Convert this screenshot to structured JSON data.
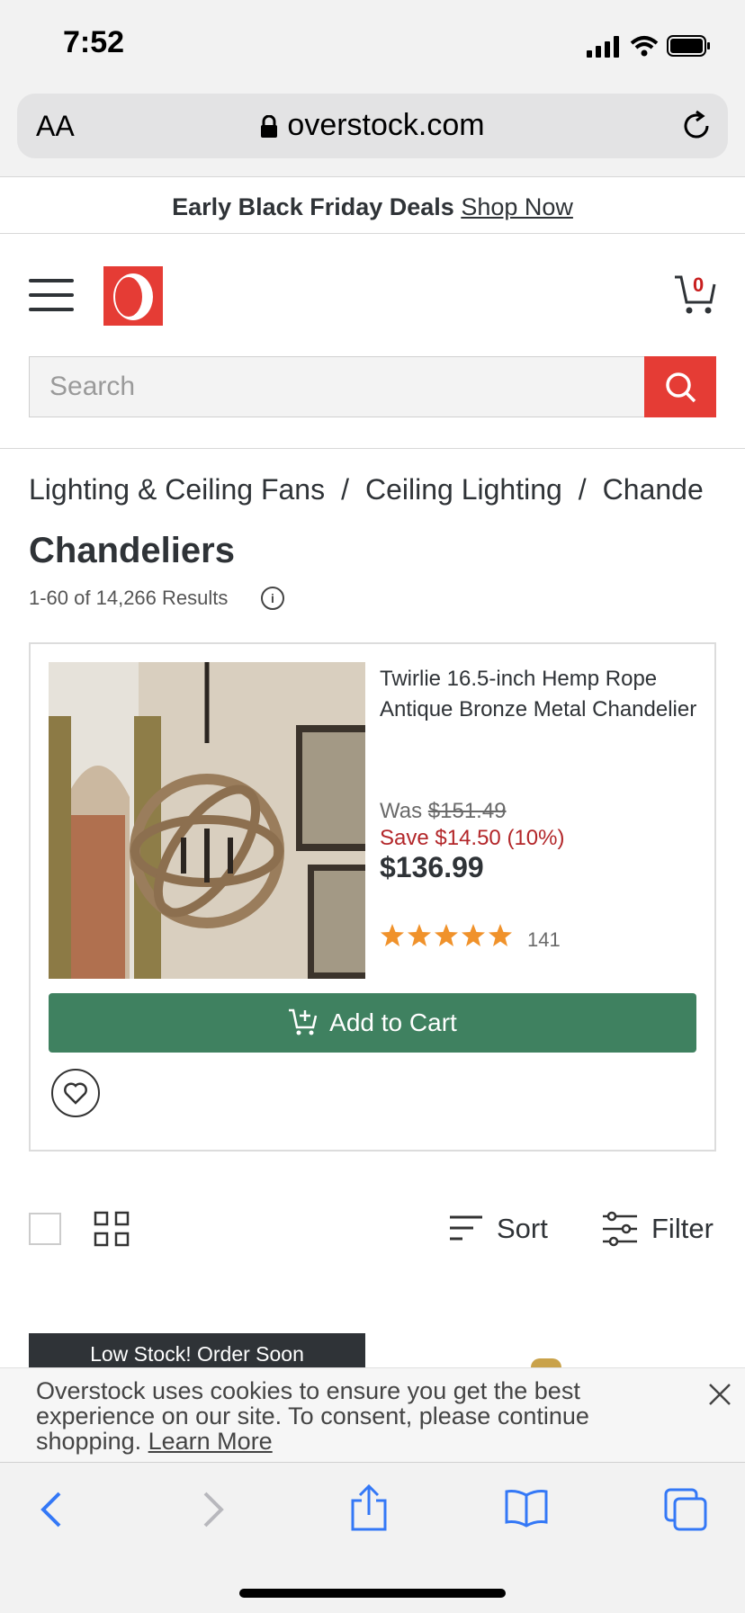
{
  "status_bar": {
    "time": "7:52"
  },
  "browser": {
    "text_size_label": "AA",
    "url": "overstock.com"
  },
  "promo": {
    "text": "Early Black Friday Deals",
    "link": "Shop Now"
  },
  "header": {
    "cart_count": "0",
    "search_placeholder": "Search"
  },
  "breadcrumb": {
    "items": [
      "Lighting & Ceiling Fans",
      "Ceiling Lighting",
      "Chande"
    ],
    "separator": "/"
  },
  "page": {
    "title": "Chandeliers",
    "results": "1-60 of 14,266 Results"
  },
  "product": {
    "title": "Twirlie 16.5-inch Hemp Rope Antique Bronze Metal Chandelier",
    "was_label": "Was",
    "was_price": "$151.49",
    "save": "Save $14.50 (10%)",
    "price": "$136.99",
    "rating": 5,
    "review_count": "141",
    "add_to_cart": "Add to Cart"
  },
  "toolbar": {
    "sort": "Sort",
    "filter": "Filter"
  },
  "badge": {
    "low_stock": "Low Stock! Order Soon"
  },
  "cookie": {
    "text": "Overstock uses cookies to ensure you get the best experience on our site. To consent, please continue shopping.",
    "link": "Learn More"
  },
  "colors": {
    "brand": "#e53c35",
    "cart_button": "#3f8160",
    "save_text": "#b3272a",
    "stars": "#f0922b",
    "safari_blue": "#3478f6"
  }
}
